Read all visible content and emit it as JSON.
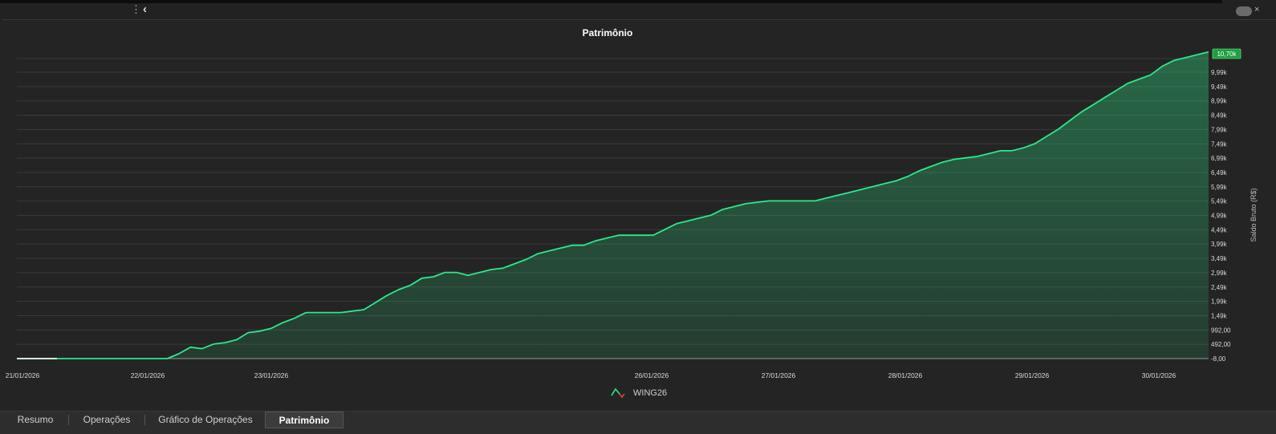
{
  "toolbar": {
    "menu_icon": "vertical-dots-icon",
    "collapse_icon": "chevron-left-icon",
    "toggle_icon": "toggle-icon",
    "close_icon": "close-icon"
  },
  "colors": {
    "line": "#2ee88a",
    "fill": "#2ee88a",
    "grid": "#3a3a3a",
    "background": "#242424",
    "text": "#d8d8d8",
    "badge": "#1e9e3e",
    "legend_down": "#e04040"
  },
  "chart_data": {
    "type": "area",
    "title": "Patrimônio",
    "ylabel": "Saldo Bruto (R$)",
    "xlabel": "",
    "ylim": [
      -8,
      10500
    ],
    "grid": true,
    "legend_position": "bottom-center",
    "y_ticks": [
      "-8,00",
      "492,00",
      "992,00",
      "1,49k",
      "1,99k",
      "2,49k",
      "2,99k",
      "3,49k",
      "3,99k",
      "4,49k",
      "4,99k",
      "5,49k",
      "5,99k",
      "6,49k",
      "6,99k",
      "7,49k",
      "7,99k",
      "8,49k",
      "8,99k",
      "9,49k",
      "9,99k"
    ],
    "y_tick_values": [
      -8,
      492,
      992,
      1492,
      1992,
      2492,
      2992,
      3492,
      3992,
      4492,
      4992,
      5492,
      5992,
      6492,
      6992,
      7492,
      7992,
      8492,
      8992,
      9492,
      9992
    ],
    "x_ticks": [
      "21/01/2026",
      "22/01/2026",
      "23/01/2026",
      "26/01/2026",
      "27/01/2026",
      "28/01/2026",
      "29/01/2026",
      "30/01/2026"
    ],
    "last_value_label": "10,70k",
    "series": [
      {
        "name": "WING26",
        "y": [
          -8,
          -8,
          -8,
          -8,
          -8,
          -8,
          -8,
          -8,
          -8,
          -8,
          -8,
          -8,
          -8,
          -8,
          160,
          390,
          340,
          500,
          550,
          650,
          900,
          950,
          1050,
          1250,
          1400,
          1600,
          1600,
          1600,
          1600,
          1650,
          1700,
          1950,
          2200,
          2400,
          2550,
          2800,
          2850,
          3000,
          3000,
          2900,
          3000,
          3100,
          3150,
          3300,
          3450,
          3650,
          3750,
          3850,
          3950,
          3950,
          4100,
          4200,
          4300,
          4300,
          4300,
          4300,
          4500,
          4700,
          4800,
          4900,
          5000,
          5200,
          5300,
          5400,
          5450,
          5500,
          5500,
          5500,
          5500,
          5500,
          5600,
          5700,
          5800,
          5900,
          6000,
          6100,
          6200,
          6350,
          6550,
          6700,
          6850,
          6950,
          7000,
          7050,
          7150,
          7250,
          7250,
          7350,
          7500,
          7750,
          8000,
          8300,
          8600,
          8850,
          9100,
          9350,
          9600,
          9750,
          9900,
          10200,
          10400,
          10500,
          10600,
          10700
        ],
        "gain_color": "#2ee88a",
        "loss_color": "#e04040"
      }
    ]
  },
  "tabs": [
    {
      "label": "Resumo",
      "active": false
    },
    {
      "label": "Operações",
      "active": false
    },
    {
      "label": "Gráfico de Operações",
      "active": false
    },
    {
      "label": "Patrimônio",
      "active": true
    }
  ]
}
